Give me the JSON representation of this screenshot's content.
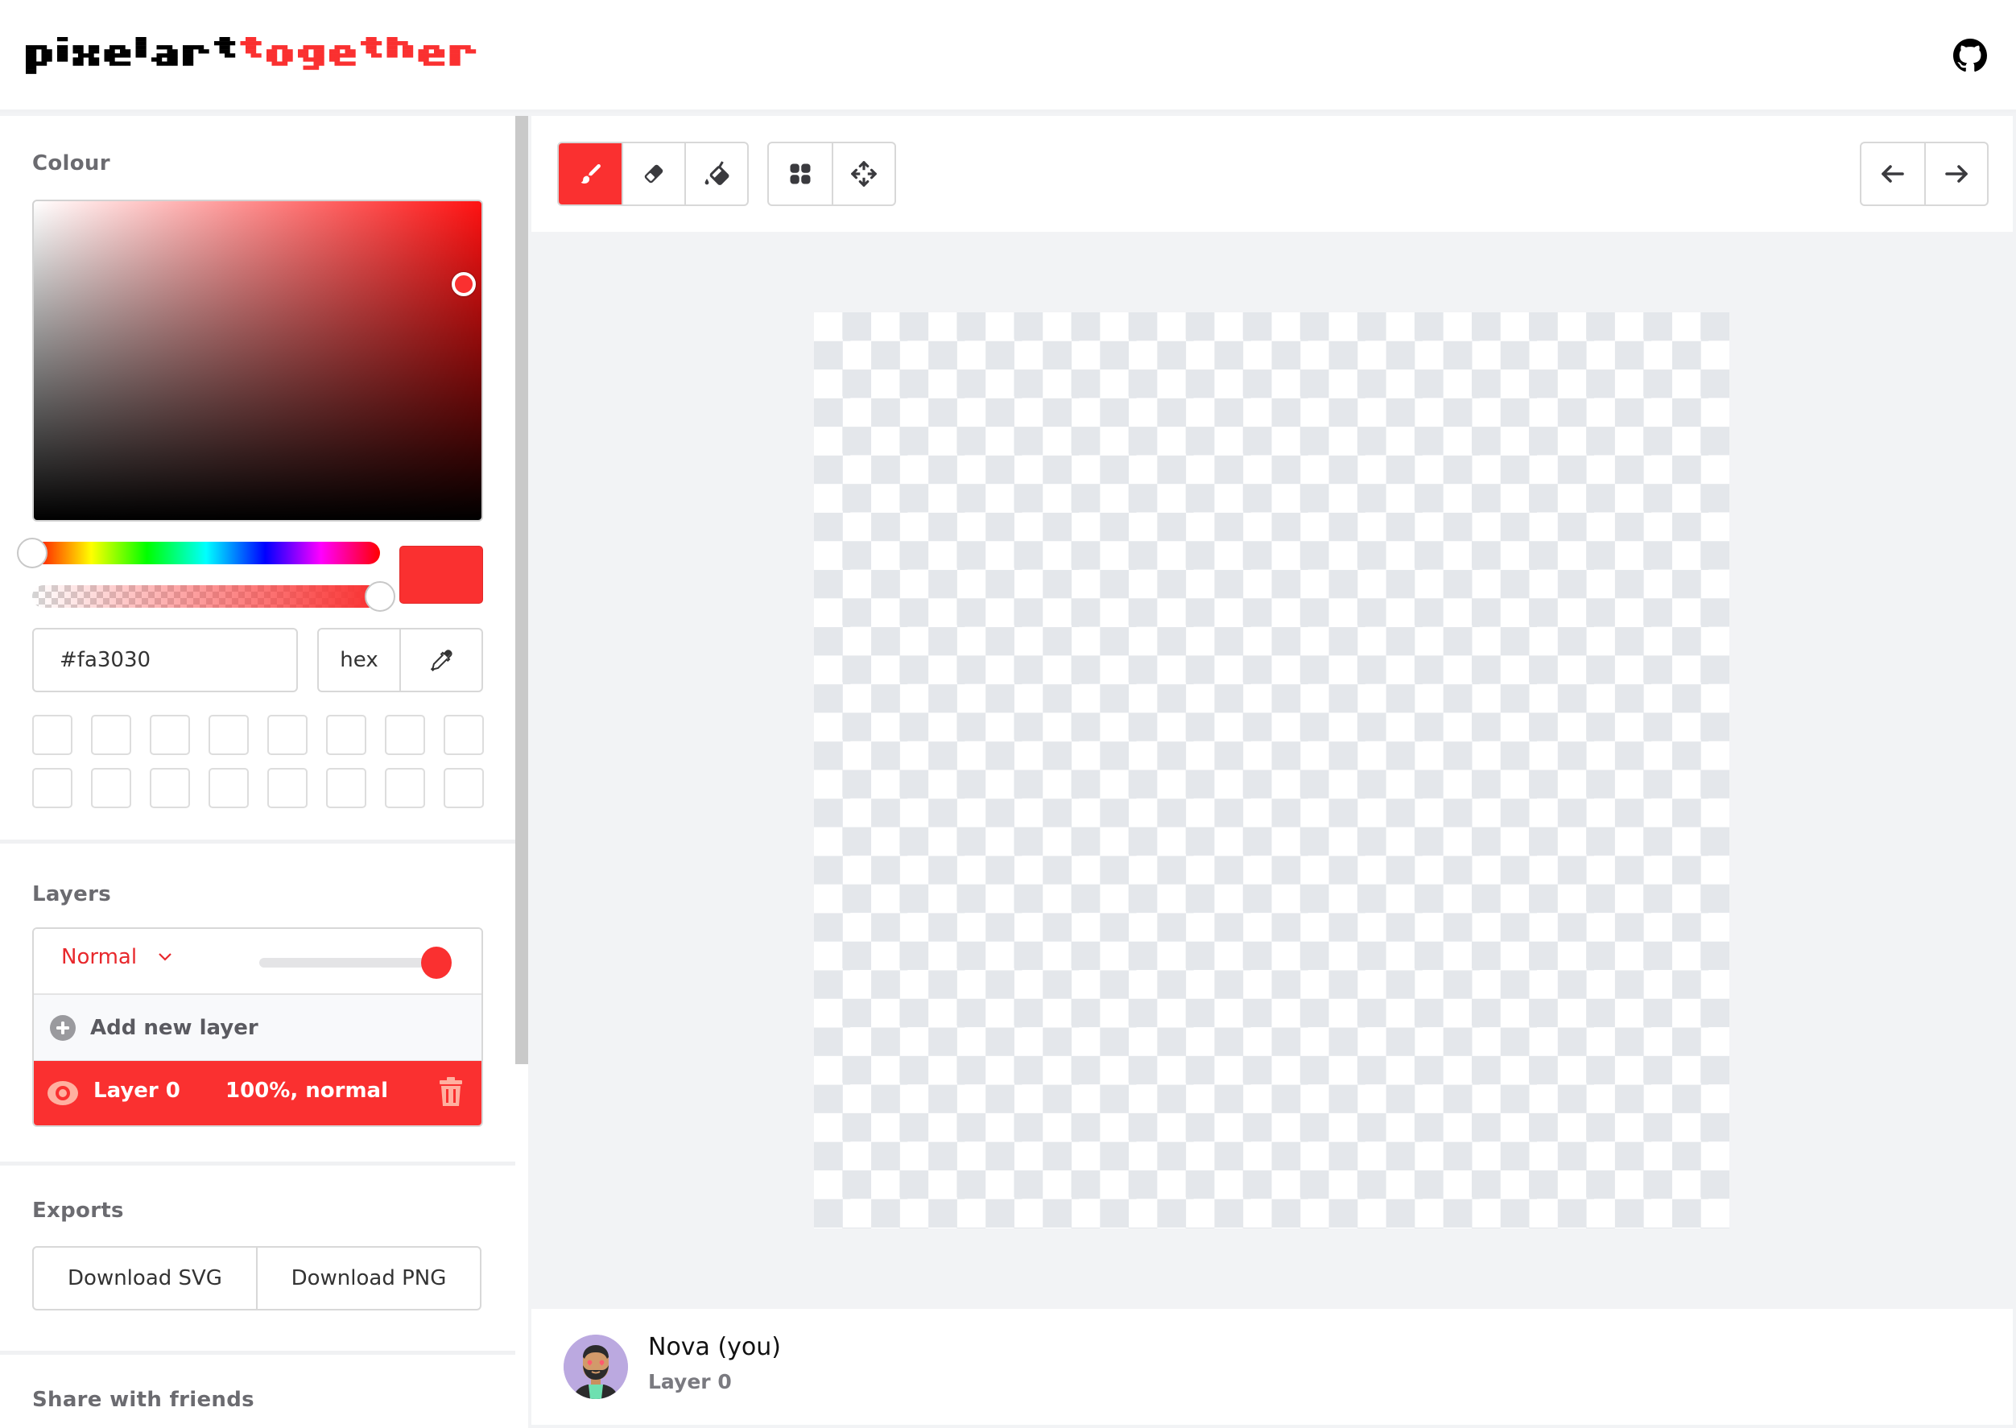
{
  "header": {
    "logo_part1": "pixelart",
    "logo_part2": "together",
    "github_icon": "github-icon"
  },
  "colors": {
    "accent": "#fa3030",
    "logo_dark": "#000000"
  },
  "colour": {
    "title": "Colour",
    "hex_value": "#fa3030",
    "format_label": "hex",
    "eyedropper_icon": "eyedropper-icon",
    "saturation": 0.96,
    "value": 0.74,
    "hue": 0,
    "alpha": 1.0,
    "palette_slots": 16
  },
  "layers": {
    "title": "Layers",
    "blend_mode": "Normal",
    "opacity": 1.0,
    "add_label": "Add new layer",
    "items": [
      {
        "name": "Layer 0",
        "info": "100%, normal",
        "visible": true,
        "selected": true
      }
    ]
  },
  "exports": {
    "title": "Exports",
    "buttons": [
      "Download SVG",
      "Download PNG"
    ]
  },
  "share": {
    "title": "Share with friends"
  },
  "toolbar": {
    "tools": [
      {
        "name": "brush",
        "icon": "paintbrush-icon",
        "active": true
      },
      {
        "name": "eraser",
        "icon": "eraser-icon",
        "active": false
      },
      {
        "name": "fill",
        "icon": "paint-bucket-icon",
        "active": false
      }
    ],
    "view_tools": [
      {
        "name": "grid",
        "icon": "grid-icon"
      },
      {
        "name": "move",
        "icon": "move-icon"
      }
    ],
    "history": [
      {
        "name": "undo",
        "icon": "arrow-left-icon"
      },
      {
        "name": "redo",
        "icon": "arrow-right-icon"
      }
    ]
  },
  "canvas": {
    "grid_cols": 32,
    "grid_rows": 32
  },
  "users": [
    {
      "name": "Nova (you)",
      "layer": "Layer 0"
    }
  ]
}
